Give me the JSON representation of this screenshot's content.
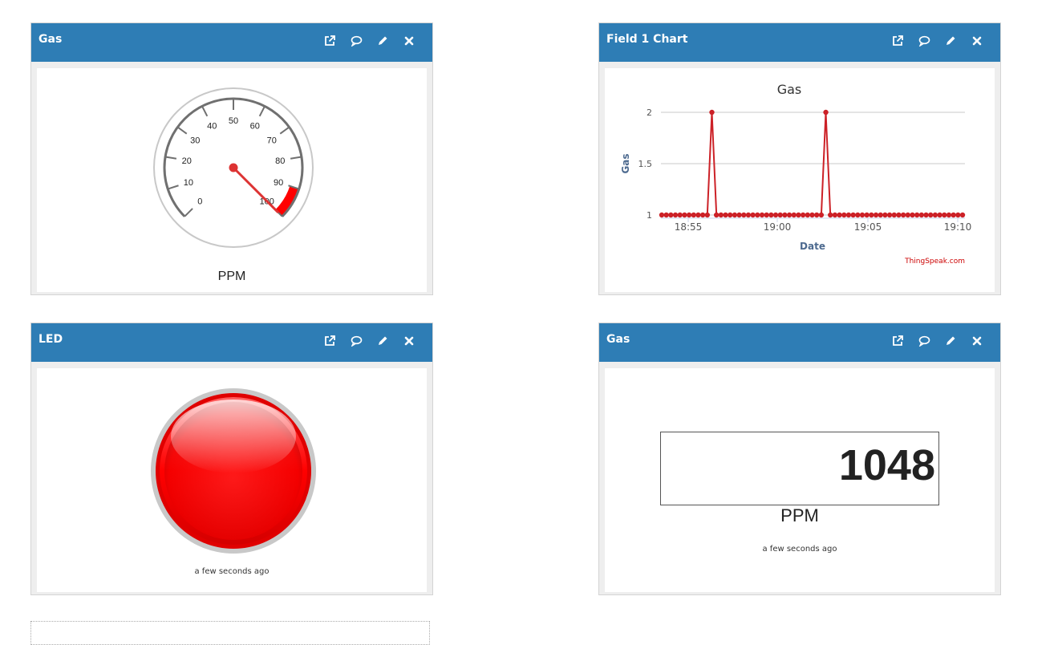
{
  "widgets": {
    "gauge": {
      "title": "Gas",
      "label": "PPM",
      "value": 100,
      "min": 0,
      "max": 100,
      "ticks": [
        "0",
        "10",
        "20",
        "30",
        "40",
        "50",
        "60",
        "70",
        "80",
        "90",
        "100"
      ],
      "danger_from": 90,
      "danger_color": "#ff0000"
    },
    "chart": {
      "title": "Field 1 Chart",
      "attribution": "ThingSpeak.com"
    },
    "led": {
      "title": "LED",
      "status": "on",
      "color": "#ff0000",
      "updated": "a few seconds ago"
    },
    "numeric": {
      "title": "Gas",
      "value": "1048",
      "unit": "PPM",
      "updated": "a few seconds ago"
    }
  },
  "header_icons": [
    "external-link-icon",
    "comment-icon",
    "pencil-icon",
    "close-icon"
  ],
  "colors": {
    "header": "#2e7db5",
    "series": "#cc2127",
    "needle": "#dd3333"
  },
  "chart_data": {
    "type": "line",
    "title": "Gas",
    "xlabel": "Date",
    "ylabel": "Gas",
    "x_tick_labels": [
      "18:55",
      "19:00",
      "19:05",
      "19:10"
    ],
    "y_ticks": [
      1,
      1.5,
      2
    ],
    "ylim": [
      1,
      2
    ],
    "grid": true,
    "series": [
      {
        "values": [
          1,
          1,
          1,
          1,
          1,
          1,
          1,
          1,
          1,
          1,
          1,
          2,
          1,
          1,
          1,
          1,
          1,
          1,
          1,
          1,
          1,
          1,
          1,
          1,
          1,
          1,
          1,
          1,
          1,
          1,
          1,
          1,
          1,
          1,
          1,
          1,
          2,
          1,
          1,
          1,
          1,
          1,
          1,
          1,
          1,
          1,
          1,
          1,
          1,
          1,
          1,
          1,
          1,
          1,
          1,
          1,
          1,
          1,
          1,
          1,
          1,
          1,
          1,
          1,
          1,
          1,
          1
        ]
      }
    ]
  }
}
